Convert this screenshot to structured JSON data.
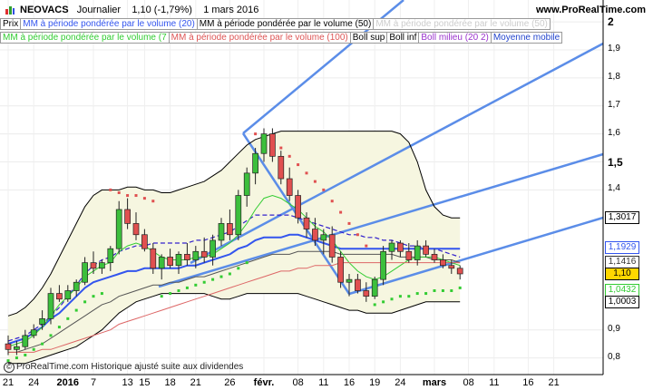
{
  "header": {
    "symbol": "NEOVACS",
    "period": "Journalier",
    "price_change": "1,10 (-1,79%)",
    "date": "1 mars 2016",
    "site": "www.ProRealTime.com"
  },
  "legend_row1": [
    {
      "label": "Prix",
      "color": "#000000"
    },
    {
      "label": "MM à période pondérée par le volume (20)",
      "color": "#3355ee"
    },
    {
      "label": "MM à période pondérée par le volume (50)",
      "color": "#000000"
    },
    {
      "label": "MM à période pondérée par le volume (50)",
      "color": "#cccccc"
    }
  ],
  "legend_row2": [
    {
      "label": "MM à période pondérée par le volume (7",
      "color": "#33cc33"
    },
    {
      "label": "MM à période pondérée par le volume (100)",
      "color": "#dd5555"
    },
    {
      "label": "Boll sup",
      "color": "#000000"
    },
    {
      "label": "Boll inf",
      "color": "#000000"
    },
    {
      "label": "Boll milieu (20 2)",
      "color": "#9933cc"
    },
    {
      "label": "Moyenne mobile",
      "color": "#2244cc"
    }
  ],
  "footer": {
    "text": "ProRealTime.com Historique ajusté suite aux dividendes"
  },
  "axis": {
    "y_ticks": [
      "2",
      "1,9",
      "1,8",
      "1,7",
      "1,6",
      "1,5",
      "1,4",
      "0,9",
      "0,8"
    ],
    "y_tick_values": [
      2.0,
      1.9,
      1.8,
      1.7,
      1.6,
      1.5,
      1.4,
      0.9,
      0.8
    ],
    "x_ticks": [
      "21",
      "24",
      "2016",
      "7",
      "13",
      "15",
      "18",
      "21",
      "26",
      "févr.",
      "08",
      "11",
      "16",
      "19",
      "24",
      "mars",
      "08",
      "11",
      "16",
      "21"
    ],
    "x_tick_index": [
      0,
      3,
      7,
      10,
      14,
      16,
      19,
      22,
      26,
      30,
      34,
      37,
      40,
      43,
      46,
      50,
      54,
      57,
      61,
      64
    ]
  },
  "value_boxes": [
    {
      "label": "1,3017",
      "value": 1.3017,
      "color": "#000000"
    },
    {
      "label": "1,1929",
      "value": 1.1929,
      "color": "#3355ee"
    },
    {
      "label": "1,1416",
      "value": 1.1416,
      "color": "#333333"
    },
    {
      "label": "1,10",
      "value": 1.1,
      "color": "#000000",
      "fill": "#ffd700"
    },
    {
      "label": "1,0432",
      "value": 1.0432,
      "color": "#33cc33"
    },
    {
      "label": "1,0003",
      "value": 1.0003,
      "color": "#000000"
    }
  ],
  "colors": {
    "up": "#3cbf3c",
    "down": "#e05050",
    "band_fill": "#f6f6e0",
    "channel": "#5b8de8"
  },
  "chart_data": {
    "type": "candlestick",
    "title": "NEOVACS Journalier",
    "ylim": [
      0.75,
      2.02
    ],
    "candles": [
      {
        "o": 0.85,
        "h": 0.88,
        "l": 0.81,
        "c": 0.83
      },
      {
        "o": 0.83,
        "h": 0.86,
        "l": 0.81,
        "c": 0.84
      },
      {
        "o": 0.84,
        "h": 0.9,
        "l": 0.83,
        "c": 0.88
      },
      {
        "o": 0.88,
        "h": 0.92,
        "l": 0.87,
        "c": 0.9
      },
      {
        "o": 0.92,
        "h": 0.97,
        "l": 0.9,
        "c": 0.94
      },
      {
        "o": 0.94,
        "h": 1.05,
        "l": 0.92,
        "c": 1.03
      },
      {
        "o": 1.03,
        "h": 1.06,
        "l": 1.0,
        "c": 1.01
      },
      {
        "o": 1.01,
        "h": 1.06,
        "l": 1.0,
        "c": 1.04
      },
      {
        "o": 1.04,
        "h": 1.08,
        "l": 1.02,
        "c": 1.07
      },
      {
        "o": 1.07,
        "h": 1.16,
        "l": 1.06,
        "c": 1.14
      },
      {
        "o": 1.14,
        "h": 1.18,
        "l": 1.1,
        "c": 1.12
      },
      {
        "o": 1.12,
        "h": 1.15,
        "l": 1.1,
        "c": 1.14
      },
      {
        "o": 1.14,
        "h": 1.2,
        "l": 1.11,
        "c": 1.19
      },
      {
        "o": 1.19,
        "h": 1.36,
        "l": 1.17,
        "c": 1.33
      },
      {
        "o": 1.33,
        "h": 1.37,
        "l": 1.26,
        "c": 1.28
      },
      {
        "o": 1.28,
        "h": 1.32,
        "l": 1.22,
        "c": 1.24
      },
      {
        "o": 1.24,
        "h": 1.26,
        "l": 1.18,
        "c": 1.19
      },
      {
        "o": 1.19,
        "h": 1.21,
        "l": 1.1,
        "c": 1.12
      },
      {
        "o": 1.12,
        "h": 1.17,
        "l": 1.08,
        "c": 1.16
      },
      {
        "o": 1.16,
        "h": 1.19,
        "l": 1.12,
        "c": 1.13
      },
      {
        "o": 1.13,
        "h": 1.18,
        "l": 1.1,
        "c": 1.17
      },
      {
        "o": 1.17,
        "h": 1.21,
        "l": 1.13,
        "c": 1.15
      },
      {
        "o": 1.15,
        "h": 1.2,
        "l": 1.12,
        "c": 1.18
      },
      {
        "o": 1.18,
        "h": 1.23,
        "l": 1.14,
        "c": 1.16
      },
      {
        "o": 1.16,
        "h": 1.24,
        "l": 1.13,
        "c": 1.22
      },
      {
        "o": 1.22,
        "h": 1.3,
        "l": 1.2,
        "c": 1.28
      },
      {
        "o": 1.28,
        "h": 1.33,
        "l": 1.22,
        "c": 1.24
      },
      {
        "o": 1.24,
        "h": 1.4,
        "l": 1.22,
        "c": 1.38
      },
      {
        "o": 1.38,
        "h": 1.48,
        "l": 1.34,
        "c": 1.46
      },
      {
        "o": 1.46,
        "h": 1.55,
        "l": 1.42,
        "c": 1.53
      },
      {
        "o": 1.53,
        "h": 1.62,
        "l": 1.5,
        "c": 1.6
      },
      {
        "o": 1.6,
        "h": 1.62,
        "l": 1.5,
        "c": 1.52
      },
      {
        "o": 1.52,
        "h": 1.54,
        "l": 1.42,
        "c": 1.44
      },
      {
        "o": 1.44,
        "h": 1.48,
        "l": 1.36,
        "c": 1.38
      },
      {
        "o": 1.38,
        "h": 1.4,
        "l": 1.28,
        "c": 1.3
      },
      {
        "o": 1.3,
        "h": 1.32,
        "l": 1.23,
        "c": 1.26
      },
      {
        "o": 1.26,
        "h": 1.3,
        "l": 1.2,
        "c": 1.22
      },
      {
        "o": 1.22,
        "h": 1.26,
        "l": 1.17,
        "c": 1.24
      },
      {
        "o": 1.24,
        "h": 1.27,
        "l": 1.14,
        "c": 1.16
      },
      {
        "o": 1.16,
        "h": 1.18,
        "l": 1.05,
        "c": 1.07
      },
      {
        "o": 1.07,
        "h": 1.1,
        "l": 1.02,
        "c": 1.08
      },
      {
        "o": 1.08,
        "h": 1.1,
        "l": 1.03,
        "c": 1.04
      },
      {
        "o": 1.04,
        "h": 1.07,
        "l": 1.0,
        "c": 1.02
      },
      {
        "o": 1.02,
        "h": 1.09,
        "l": 1.01,
        "c": 1.08
      },
      {
        "o": 1.08,
        "h": 1.2,
        "l": 1.06,
        "c": 1.18
      },
      {
        "o": 1.18,
        "h": 1.22,
        "l": 1.15,
        "c": 1.21
      },
      {
        "o": 1.21,
        "h": 1.22,
        "l": 1.16,
        "c": 1.18
      },
      {
        "o": 1.18,
        "h": 1.21,
        "l": 1.14,
        "c": 1.15
      },
      {
        "o": 1.15,
        "h": 1.22,
        "l": 1.13,
        "c": 1.2
      },
      {
        "o": 1.2,
        "h": 1.22,
        "l": 1.16,
        "c": 1.17
      },
      {
        "o": 1.17,
        "h": 1.19,
        "l": 1.14,
        "c": 1.15
      },
      {
        "o": 1.15,
        "h": 1.17,
        "l": 1.12,
        "c": 1.13
      },
      {
        "o": 1.13,
        "h": 1.15,
        "l": 1.1,
        "c": 1.12
      },
      {
        "o": 1.12,
        "h": 1.13,
        "l": 1.08,
        "c": 1.1
      }
    ],
    "series": [
      {
        "name": "Boll sup",
        "values": [
          0.95,
          0.96,
          0.98,
          1.01,
          1.05,
          1.1,
          1.16,
          1.22,
          1.28,
          1.34,
          1.38,
          1.4,
          1.4,
          1.4,
          1.41,
          1.41,
          1.4,
          1.4,
          1.39,
          1.39,
          1.4,
          1.41,
          1.42,
          1.43,
          1.45,
          1.47,
          1.5,
          1.53,
          1.56,
          1.58,
          1.59,
          1.6,
          1.61,
          1.61,
          1.61,
          1.61,
          1.61,
          1.61,
          1.61,
          1.61,
          1.61,
          1.61,
          1.61,
          1.61,
          1.61,
          1.61,
          1.6,
          1.57,
          1.5,
          1.4,
          1.34,
          1.31,
          1.3,
          1.3
        ]
      },
      {
        "name": "Boll inf",
        "values": [
          0.78,
          0.78,
          0.78,
          0.79,
          0.8,
          0.81,
          0.82,
          0.83,
          0.84,
          0.86,
          0.88,
          0.9,
          0.93,
          0.96,
          0.98,
          1.0,
          1.01,
          1.02,
          1.03,
          1.03,
          1.03,
          1.03,
          1.03,
          1.03,
          1.02,
          1.01,
          1.01,
          1.02,
          1.03,
          1.03,
          1.03,
          1.03,
          1.03,
          1.03,
          1.03,
          1.02,
          1.01,
          1.0,
          0.99,
          0.98,
          0.97,
          0.97,
          0.96,
          0.96,
          0.96,
          0.96,
          0.97,
          0.98,
          0.99,
          1.0,
          1.0,
          1.0,
          1.0,
          1.0
        ]
      },
      {
        "name": "Boll milieu (20 2)",
        "values": [
          0.86,
          0.87,
          0.88,
          0.9,
          0.92,
          0.95,
          0.98,
          1.02,
          1.06,
          1.1,
          1.13,
          1.15,
          1.16,
          1.18,
          1.19,
          1.2,
          1.2,
          1.21,
          1.21,
          1.21,
          1.21,
          1.21,
          1.22,
          1.22,
          1.23,
          1.24,
          1.25,
          1.27,
          1.29,
          1.31,
          1.31,
          1.31,
          1.31,
          1.31,
          1.3,
          1.29,
          1.28,
          1.27,
          1.26,
          1.25,
          1.24,
          1.24,
          1.23,
          1.23,
          1.22,
          1.22,
          1.21,
          1.2,
          1.2,
          1.19,
          1.19,
          1.18,
          1.17,
          1.16
        ]
      },
      {
        "name": "MM à période pondérée par le volume (20)",
        "values": [
          0.85,
          0.86,
          0.87,
          0.89,
          0.91,
          0.94,
          0.96,
          0.99,
          1.02,
          1.05,
          1.07,
          1.08,
          1.09,
          1.1,
          1.11,
          1.11,
          1.12,
          1.12,
          1.12,
          1.12,
          1.12,
          1.13,
          1.13,
          1.14,
          1.15,
          1.16,
          1.17,
          1.19,
          1.2,
          1.22,
          1.23,
          1.23,
          1.23,
          1.24,
          1.24,
          1.23,
          1.22,
          1.21,
          1.2,
          1.19,
          1.19,
          1.19,
          1.19,
          1.19,
          1.19,
          1.19,
          1.19,
          1.19,
          1.19,
          1.19,
          1.19,
          1.19,
          1.19,
          1.19
        ]
      },
      {
        "name": "MM à période pondérée par le volume (50)",
        "values": [
          0.82,
          0.82,
          0.83,
          0.84,
          0.85,
          0.87,
          0.89,
          0.91,
          0.93,
          0.95,
          0.97,
          0.99,
          1.0,
          1.02,
          1.03,
          1.04,
          1.05,
          1.06,
          1.06,
          1.07,
          1.07,
          1.08,
          1.09,
          1.09,
          1.1,
          1.11,
          1.12,
          1.13,
          1.14,
          1.15,
          1.16,
          1.17,
          1.17,
          1.17,
          1.18,
          1.18,
          1.18,
          1.18,
          1.18,
          1.17,
          1.17,
          1.17,
          1.17,
          1.17,
          1.17,
          1.17,
          1.16,
          1.16,
          1.16,
          1.16,
          1.15,
          1.15,
          1.15,
          1.14
        ]
      },
      {
        "name": "MM à période pondérée par le volume (7",
        "values": [
          0.84,
          0.85,
          0.86,
          0.88,
          0.91,
          0.95,
          0.99,
          1.02,
          1.05,
          1.09,
          1.11,
          1.13,
          1.14,
          1.18,
          1.2,
          1.21,
          1.2,
          1.18,
          1.16,
          1.15,
          1.15,
          1.15,
          1.16,
          1.16,
          1.17,
          1.19,
          1.21,
          1.24,
          1.28,
          1.33,
          1.37,
          1.38,
          1.37,
          1.35,
          1.33,
          1.3,
          1.27,
          1.25,
          1.22,
          1.18,
          1.14,
          1.11,
          1.09,
          1.08,
          1.09,
          1.11,
          1.13,
          1.15,
          1.16,
          1.16,
          1.16,
          1.15,
          1.14,
          1.13
        ]
      },
      {
        "name": "MM à période pondérée par le volume (100)",
        "values": [
          0.82,
          0.82,
          0.82,
          0.82,
          0.83,
          0.83,
          0.84,
          0.85,
          0.86,
          0.87,
          0.88,
          0.89,
          0.9,
          0.92,
          0.93,
          0.94,
          0.95,
          0.96,
          0.97,
          0.98,
          0.99,
          1.0,
          1.01,
          1.02,
          1.03,
          1.04,
          1.05,
          1.06,
          1.07,
          1.08,
          1.09,
          1.1,
          1.11,
          1.11,
          1.12,
          1.12,
          1.13,
          1.13,
          1.13,
          1.14,
          1.14,
          1.14,
          1.14,
          1.14,
          1.14,
          1.14,
          1.14,
          1.14,
          1.14,
          1.14,
          1.14,
          1.14,
          1.14,
          1.14
        ]
      }
    ],
    "sar": [
      0.79,
      0.8,
      0.81,
      0.83,
      0.85,
      0.88,
      0.91,
      0.94,
      0.97,
      1.0,
      1.02,
      1.03,
      1.4,
      1.39,
      1.38,
      1.38,
      1.37,
      1.36,
      1.02,
      1.03,
      1.04,
      1.05,
      1.06,
      1.07,
      1.08,
      1.09,
      1.1,
      1.12,
      1.14,
      1.6,
      1.58,
      1.57,
      1.55,
      1.52,
      1.49,
      1.46,
      1.43,
      1.4,
      1.36,
      1.32,
      1.28,
      1.24,
      1.2,
      0.99,
      1.0,
      1.01,
      1.02,
      1.02,
      1.03,
      1.03,
      1.04,
      1.04,
      1.04,
      1.05
    ]
  }
}
